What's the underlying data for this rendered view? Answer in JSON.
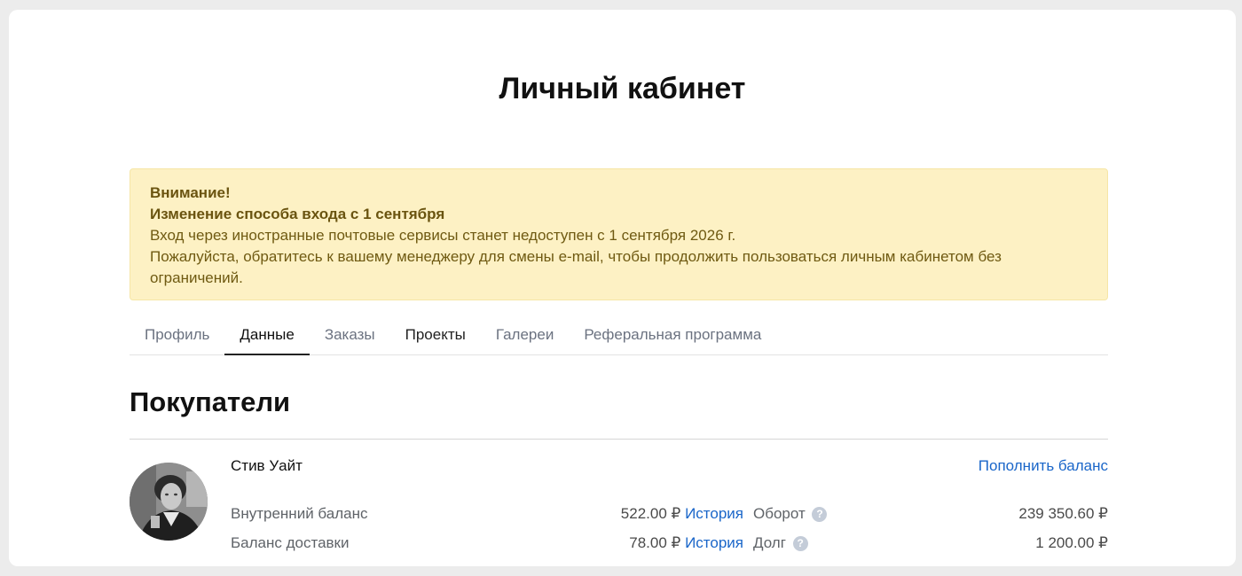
{
  "page": {
    "title": "Личный кабинет"
  },
  "alert": {
    "heading": "Внимание!",
    "subheading": "Изменение способа входа с 1 сентября",
    "line1": "Вход через иностранные почтовые сервисы станет недоступен с 1 сентября 2026 г.",
    "line2": "Пожалуйста, обратитесь к вашему менеджеру для смены e-mail, чтобы продолжить пользоваться личным кабинетом без",
    "line3": "ограничений."
  },
  "tabs": [
    {
      "label": "Профиль"
    },
    {
      "label": "Данные",
      "active": true
    },
    {
      "label": "Заказы"
    },
    {
      "label": "Проекты"
    },
    {
      "label": "Галереи"
    },
    {
      "label": "Реферальная программа"
    }
  ],
  "section": {
    "title": "Покупатели"
  },
  "buyer": {
    "name": "Стив Уайт",
    "topup_label": "Пополнить баланс",
    "internal_balance": {
      "label": "Внутренний баланс",
      "amount": "522.00 ₽",
      "history_label": "История"
    },
    "delivery_balance": {
      "label": "Баланс доставки",
      "amount": "78.00 ₽",
      "history_label": "История"
    },
    "turnover": {
      "label": "Оборот",
      "value": "239 350.60 ₽",
      "icon": "help-icon"
    },
    "debt": {
      "label": "Долг",
      "value": "1 200.00 ₽",
      "icon": "help-icon"
    }
  },
  "colors": {
    "alert_bg": "#fdf1c4",
    "alert_text": "#6f5a12",
    "link": "#1a66c9",
    "background": "#ececec"
  }
}
